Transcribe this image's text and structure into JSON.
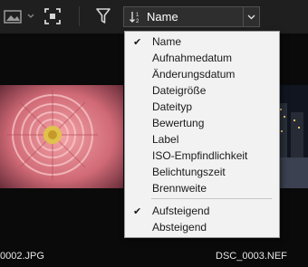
{
  "toolbar": {
    "icons": [
      "image-view-icon",
      "fit-screen-icon",
      "filter-icon",
      "sort-order-icon"
    ],
    "sort_value": "Name"
  },
  "thumbnails": [
    {
      "filename": "0002.JPG"
    },
    {
      "filename": "DSC_0003.NEF"
    }
  ],
  "sort_menu": {
    "fields": [
      {
        "label": "Name",
        "checked": true
      },
      {
        "label": "Aufnahmedatum",
        "checked": false
      },
      {
        "label": "Änderungsdatum",
        "checked": false
      },
      {
        "label": "Dateigröße",
        "checked": false
      },
      {
        "label": "Dateityp",
        "checked": false
      },
      {
        "label": "Bewertung",
        "checked": false
      },
      {
        "label": "Label",
        "checked": false
      },
      {
        "label": "ISO-Empfindlichkeit",
        "checked": false
      },
      {
        "label": "Belichtungszeit",
        "checked": false
      },
      {
        "label": "Brennweite",
        "checked": false
      }
    ],
    "order": [
      {
        "label": "Aufsteigend",
        "checked": true
      },
      {
        "label": "Absteigend",
        "checked": false
      }
    ]
  },
  "colors": {
    "menu_bg": "#f2f2f2",
    "toolbar_bg": "#1f1f1f"
  }
}
